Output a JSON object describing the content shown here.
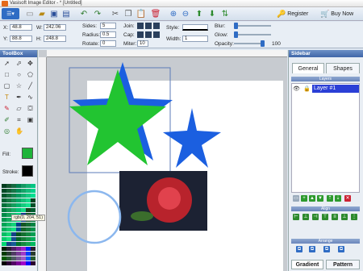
{
  "app": {
    "title": "Vasisoft Image Editor - * [Untitled]"
  },
  "toolbar": {
    "register_label": "Register",
    "buy_label": "Buy Now"
  },
  "props": {
    "x_label": "X:",
    "x_value": "48.8",
    "y_label": "Y:",
    "y_value": "88.8",
    "w_label": "W:",
    "w_value": "242.06",
    "h_label": "H:",
    "h_value": "248.8",
    "sides_label": "Sides:",
    "sides_value": "5",
    "radius_label": "Radius:",
    "radius_value": "0.5",
    "rotate_label": "Rotate:",
    "rotate_value": "0",
    "join_label": "Join:",
    "cap_label": "Cap:",
    "miter_label": "Miter:",
    "miter_value": "10",
    "style_label": "Style:",
    "width_label": "Width:",
    "width_value": "1",
    "blur_label": "Blur:",
    "glow_label": "Glow:",
    "opacity_label": "Opacity:",
    "opacity_value": "100",
    "blur_level": 0,
    "glow_level": 0,
    "opacity_level": 1.0
  },
  "toolbox": {
    "title": "ToolBox",
    "fill_label": "Fill:",
    "stroke_label": "Stroke:",
    "fill_color": "#1fb43a",
    "stroke_color": "#000000",
    "tooltip": "rgb(0, 204, 51)"
  },
  "sidebar": {
    "title": "Sidebar",
    "tab_general": "General",
    "tab_shapes": "Shapes",
    "layers_header": "Layers",
    "layer_name": "Layer #1",
    "align_header": "Align",
    "arrange_header": "Arrange",
    "gradient_label": "Gradient",
    "pattern_label": "Pattern"
  },
  "colors": {
    "star_green": "#22c431",
    "star_blue": "#1b5fe0",
    "accent": "#3f66a8",
    "layer_highlight": "#2b3fd6"
  }
}
